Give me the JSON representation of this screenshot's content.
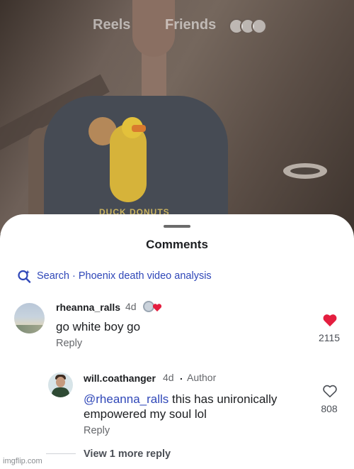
{
  "top_nav": {
    "reels_label": "Reels",
    "friends_label": "Friends"
  },
  "video": {
    "shirt_print_text": "DUCK DONUTS"
  },
  "comments_sheet": {
    "title": "Comments",
    "search": {
      "prefix": "Search",
      "separator": " · ",
      "query": "Phoenix death video analysis"
    },
    "comments": [
      {
        "username": "rheanna_ralls",
        "age": "4d",
        "text": "go white boy go",
        "reply_label": "Reply",
        "like_count": "2115",
        "liked": true
      }
    ],
    "replies": [
      {
        "username": "will.coathanger",
        "age": "4d",
        "dot": ".",
        "badge": "Author",
        "mention": "@rheanna_ralls",
        "text": " this has unironically empowered my soul lol",
        "reply_label": "Reply",
        "like_count": "808",
        "liked": false
      }
    ],
    "view_more_label": "View 1 more reply"
  },
  "watermark": "imgflip.com",
  "colors": {
    "like_red": "#e41e3f",
    "link_blue": "#2f47b8",
    "sheet_bg": "#ffffff"
  },
  "icons": {
    "search": "search-sparkle-icon",
    "liked": "heart-filled-icon",
    "unliked": "heart-outline-icon"
  }
}
